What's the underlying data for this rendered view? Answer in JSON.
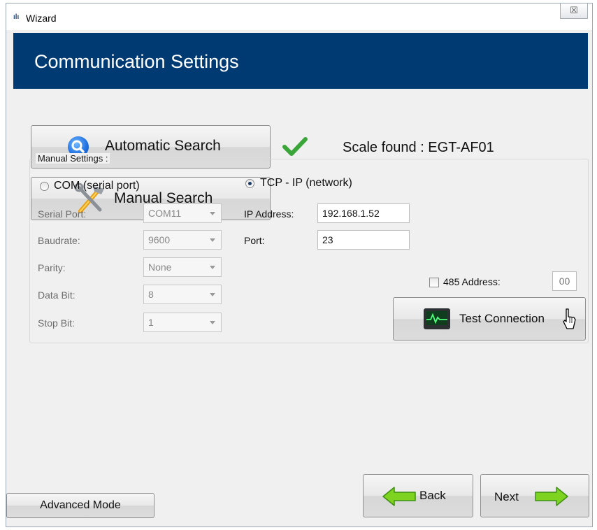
{
  "window": {
    "title": "Wizard",
    "close_glyph": "☒",
    "app_icon": "ılı"
  },
  "banner": {
    "title": "Communication Settings"
  },
  "search": {
    "automatic_label": "Automatic Search",
    "manual_label": "Manual Search",
    "status_icon": "check-icon",
    "found_text": "Scale found : EGT-AF01"
  },
  "manual_settings": {
    "title": "Manual Settings :",
    "com_option": {
      "label": "COM (serial port)",
      "selected": false
    },
    "tcp_option": {
      "label": "TCP - IP (network)",
      "selected": true
    },
    "serial": {
      "serial_port": {
        "label": "Serial Port:",
        "value": "COM11"
      },
      "baudrate": {
        "label": "Baudrate:",
        "value": "9600"
      },
      "parity": {
        "label": "Parity:",
        "value": "None"
      },
      "data_bit": {
        "label": "Data Bit:",
        "value": "8"
      },
      "stop_bit": {
        "label": "Stop Bit:",
        "value": "1"
      }
    },
    "tcp": {
      "ip_label": "IP Address:",
      "ip_value": "192.168.1.52",
      "port_label": "Port:",
      "port_value": "23"
    },
    "rs485": {
      "label": "485 Address:",
      "value": "00",
      "checked": false
    },
    "test_label": "Test Connection"
  },
  "footer": {
    "advanced_label": "Advanced Mode",
    "back_label": "Back",
    "next_label": "Next"
  },
  "colors": {
    "banner": "#003a73",
    "check": "#3aa63a",
    "arrow": "#7ed321"
  }
}
